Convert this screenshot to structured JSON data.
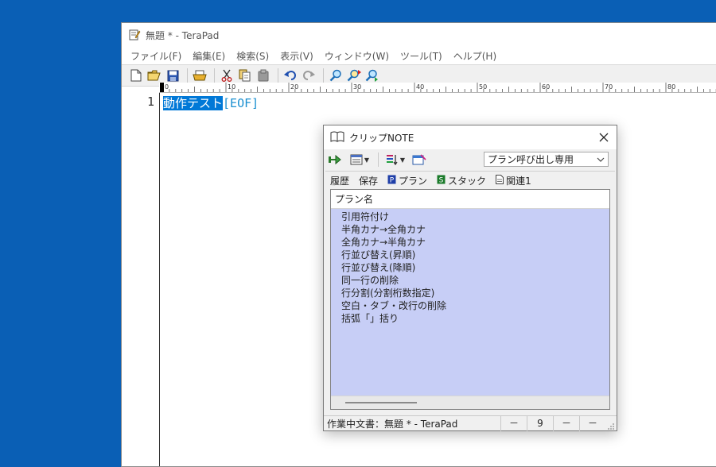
{
  "main": {
    "title": "無題 * - TeraPad",
    "menu": [
      "ファイル(F)",
      "編集(E)",
      "検索(S)",
      "表示(V)",
      "ウィンドウ(W)",
      "ツール(T)",
      "ヘルプ(H)"
    ],
    "ruler_labels": [
      "0",
      "10",
      "20",
      "30",
      "40",
      "50",
      "60",
      "70",
      "80"
    ],
    "line_number": "1",
    "selected_text": "動作テスト",
    "eof": "[EOF]",
    "toolbar_icons": [
      "new-file-icon",
      "open-folder-icon",
      "save-icon",
      "print-icon",
      "cut-icon",
      "copy-icon",
      "paste-icon",
      "undo-icon",
      "redo-icon",
      "find-icon",
      "find-next-icon",
      "find-prev-icon"
    ]
  },
  "clip": {
    "title": "クリップNOTE",
    "plan_select": "プラン呼び出し専用",
    "tabs": [
      {
        "label": "履歴",
        "icon": ""
      },
      {
        "label": "保存",
        "icon": ""
      },
      {
        "label": "プラン",
        "icon": "P"
      },
      {
        "label": "スタック",
        "icon": "S"
      },
      {
        "label": "関連1",
        "icon": ""
      }
    ],
    "list_header": "プラン名",
    "plans": [
      "引用符付け",
      "半角カナ→全角カナ",
      "全角カナ→半角カナ",
      "行並び替え(昇順)",
      "行並び替え(降順)",
      "同一行の削除",
      "行分割(分割桁数指定)",
      "空白・タブ・改行の削除",
      "括弧「」括り"
    ],
    "status": {
      "doc": "作業中文書：無題 * - TeraPad",
      "cell1": "－",
      "cell2": "9",
      "cell3": "－",
      "cell4": "－"
    }
  }
}
